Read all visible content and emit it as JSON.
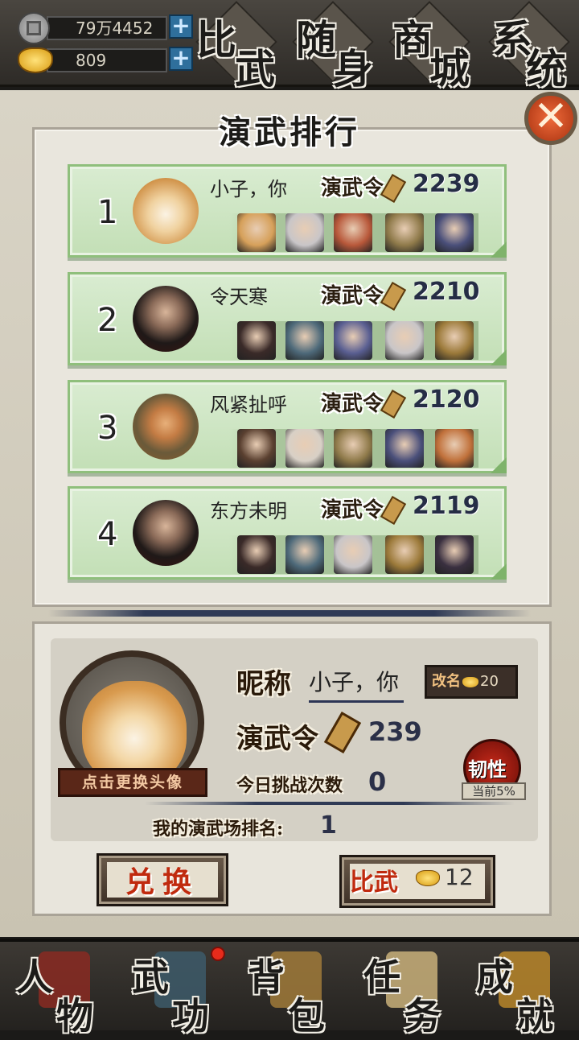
{
  "resources": [
    {
      "icon": "copper-coin-icon",
      "value": "79万4452"
    },
    {
      "icon": "gold-ingot-icon",
      "value": "809"
    }
  ],
  "top_menu": [
    {
      "a": "比",
      "b": "武"
    },
    {
      "a": "随",
      "b": "身"
    },
    {
      "a": "商",
      "b": "城"
    },
    {
      "a": "系",
      "b": "统"
    }
  ],
  "title": "演武排行",
  "token_label": "演武令",
  "ranking": [
    {
      "rank": "1",
      "name": "小子，你",
      "score": "2239",
      "avatar": "shiba-dog",
      "team": [
        "#d6a05a",
        "#c9c6c8",
        "#b8583a",
        "#8f7a4a",
        "#4a4f7a"
      ]
    },
    {
      "rank": "2",
      "name": "令天寒",
      "score": "2210",
      "avatar": "long-hair-swordsman",
      "team": [
        "#3a2a28",
        "#4e6a7a",
        "#5a5f92",
        "#c9c6c8",
        "#9c7a3a"
      ]
    },
    {
      "rank": "3",
      "name": "风紧扯呼",
      "score": "2120",
      "avatar": "bandit-with-goggles",
      "team": [
        "#5a4030",
        "#d8d0c6",
        "#8f7a4a",
        "#4a4f7a",
        "#c0703a"
      ]
    },
    {
      "rank": "4",
      "name": "东方未明",
      "score": "2119",
      "avatar": "long-hair-swordsman",
      "team": [
        "#3a2a28",
        "#4e6a7a",
        "#c9c6c8",
        "#9c7a3a",
        "#3a3040"
      ]
    }
  ],
  "me": {
    "nickname_label": "昵称",
    "nickname": "小子，你",
    "rename_label": "改名",
    "rename_cost": "20",
    "token_label": "演武令",
    "token_value": "239",
    "challenges_label": "今日挑战次数",
    "challenges": "0",
    "my_rank_label": "我的演武场排名:",
    "my_rank": "1",
    "change_avatar_label": "点击更换头像",
    "trait_label": "韧性",
    "trait_sub": "当前5%"
  },
  "buttons": {
    "exchange": "兑换",
    "fight": "比武",
    "fight_cost": "12"
  },
  "bottom_nav": [
    {
      "a": "人",
      "b": "物",
      "color": "#8a2a22"
    },
    {
      "a": "武",
      "b": "功",
      "color": "#3d5a6a"
    },
    {
      "a": "背",
      "b": "包",
      "color": "#a07a3a"
    },
    {
      "a": "任",
      "b": "务",
      "color": "#c9b07a"
    },
    {
      "a": "成",
      "b": "就",
      "color": "#b8862a"
    }
  ]
}
